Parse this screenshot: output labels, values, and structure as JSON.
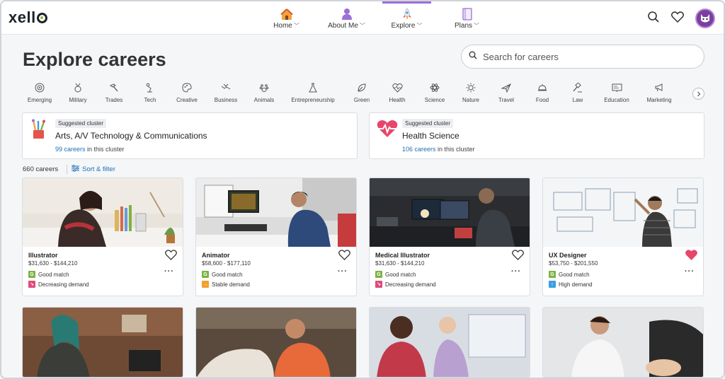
{
  "brand": {
    "logo_text": "xell"
  },
  "nav": [
    {
      "label": "Home",
      "icon": "house-icon"
    },
    {
      "label": "About Me",
      "icon": "person-icon"
    },
    {
      "label": "Explore",
      "icon": "rocket-icon",
      "active": true
    },
    {
      "label": "Plans",
      "icon": "notebook-icon"
    }
  ],
  "header": {
    "title": "Explore careers"
  },
  "search": {
    "placeholder": "Search for careers"
  },
  "categories": [
    "Emerging",
    "Military",
    "Trades",
    "Tech",
    "Creative",
    "Business",
    "Animals",
    "Entrepreneurship",
    "Green",
    "Health",
    "Science",
    "Nature",
    "Travel",
    "Food",
    "Law",
    "Education",
    "Marketing"
  ],
  "clusters": [
    {
      "badge": "Suggested cluster",
      "name": "Arts, A/V Technology & Communications",
      "count_link": "99 careers",
      "count_suffix": " in this cluster"
    },
    {
      "badge": "Suggested cluster",
      "name": "Health Science",
      "count_link": "106 careers",
      "count_suffix": " in this cluster"
    }
  ],
  "results": {
    "count": "660 careers",
    "sort_label": "Sort & filter"
  },
  "cards": [
    {
      "title": "Illustrator",
      "salary": "$31,630 - $144,210",
      "match": "Good match",
      "demand": "Decreasing demand",
      "demand_type": "decreasing",
      "favorited": false
    },
    {
      "title": "Animator",
      "salary": "$58,600 - $177,110",
      "match": "Good match",
      "demand": "Stable demand",
      "demand_type": "stable",
      "favorited": false
    },
    {
      "title": "Medical Illustrator",
      "salary": "$31,630 - $144,210",
      "match": "Good match",
      "demand": "Decreasing demand",
      "demand_type": "decreasing",
      "favorited": false
    },
    {
      "title": "UX Designer",
      "salary": "$53,750 - $201,550",
      "match": "Good match",
      "demand": "High demand",
      "demand_type": "high",
      "favorited": true
    }
  ],
  "colors": {
    "accent_purple": "#9b6fd6",
    "link_blue": "#1f6fb8",
    "good_match_green": "#7cb342",
    "decreasing_pink": "#e04a7a",
    "stable_orange": "#f0a030",
    "high_blue": "#3aa0e0",
    "heart_filled": "#e8456a"
  }
}
